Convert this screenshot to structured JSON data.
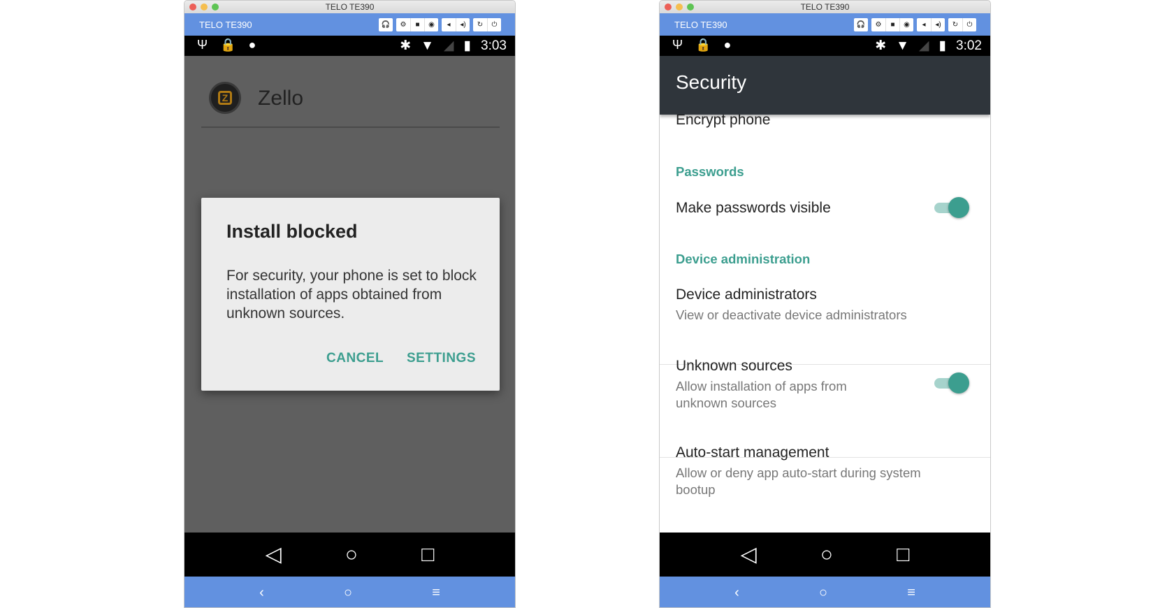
{
  "left": {
    "window_title": "TELO TE390",
    "device_name": "TELO TE390",
    "time": "3:03",
    "app_name": "Zello",
    "dialog": {
      "title": "Install blocked",
      "message": "For security, your phone is set to block installation of apps obtained from unknown sources.",
      "cancel": "CANCEL",
      "settings": "SETTINGS"
    }
  },
  "right": {
    "window_title": "TELO TE390",
    "device_name": "TELO TE390",
    "time": "3:02",
    "header": "Security",
    "encrypt": "Encrypt phone",
    "passwords_section": "Passwords",
    "make_visible": "Make passwords visible",
    "make_visible_on": true,
    "device_admin_section": "Device administration",
    "device_admins": "Device administrators",
    "device_admins_sub": "View or deactivate device administrators",
    "unknown_sources": "Unknown sources",
    "unknown_sources_sub": "Allow installation of apps from unknown sources",
    "unknown_sources_on": true,
    "autostart": "Auto-start management",
    "autostart_sub": "Allow or deny app auto-start during system bootup"
  },
  "colors": {
    "accent": "#3c9e8f",
    "toolbar": "#6291e0",
    "header": "#2f353b"
  }
}
